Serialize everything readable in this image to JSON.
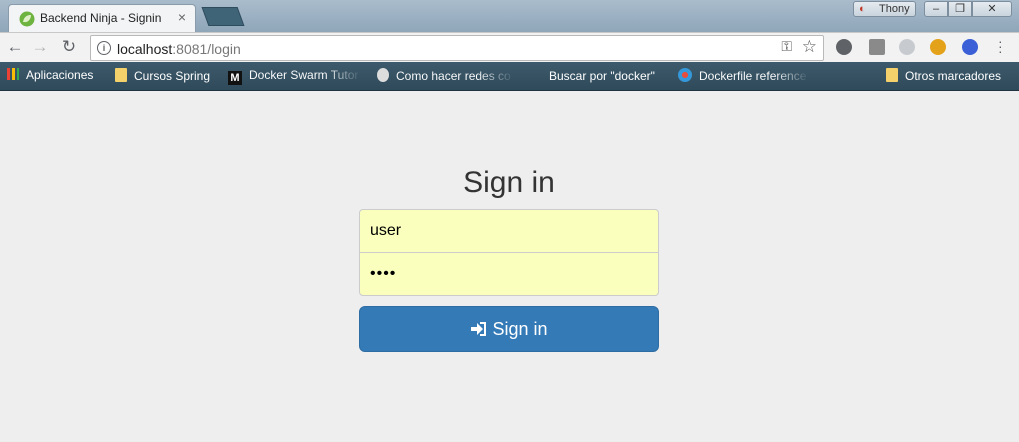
{
  "browser": {
    "tab": {
      "title": "Backend Ninja - Signin",
      "close_glyph": "×",
      "favicon": "spring-leaf-icon"
    },
    "profile_name": "Thony",
    "window_controls": {
      "minimize": "–",
      "maximize": "❐",
      "close": "✕"
    },
    "omnibox": {
      "host": "localhost",
      "path": ":8081/login"
    },
    "bookmarks": [
      {
        "label": "Aplicaciones",
        "icon": "apps-grid-icon"
      },
      {
        "label": "Cursos Spring",
        "icon": "folder-icon"
      },
      {
        "label": "Docker Swarm Tutor",
        "icon": "medium-icon"
      },
      {
        "label": "Como hacer redes co",
        "icon": "ghost-icon"
      },
      {
        "label": "Buscar por \"docker\"",
        "icon": "search-icon"
      },
      {
        "label": "Dockerfile reference",
        "icon": "docker-icon"
      },
      {
        "label": "Otros marcadores",
        "icon": "folder-icon"
      }
    ]
  },
  "page": {
    "heading": "Sign in",
    "username_value": "user",
    "password_value": "••••",
    "submit_label": "Sign in",
    "colors": {
      "background": "#eeeeee",
      "autofill": "#faffbd",
      "primary": "#337ab7"
    }
  }
}
